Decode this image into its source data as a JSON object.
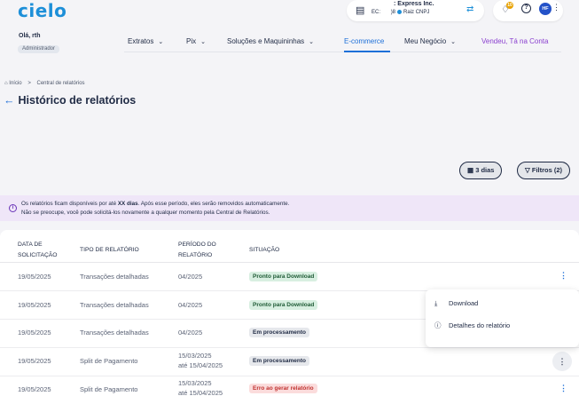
{
  "header": {
    "logo": "cielo",
    "company": {
      "name": ": Express Inc.",
      "cnpj_prefix": "EC: ",
      "cnpj_suffix": ")8",
      "root_label": "Raiz CNPJ"
    },
    "notification_count": "10",
    "help_symbol": "?",
    "avatar_initials": "HF",
    "user_greeting": "Olá,          rth",
    "role": "Administrador"
  },
  "nav": {
    "items": [
      {
        "label": "Extratos",
        "chevron": "⌄"
      },
      {
        "label": "Pix",
        "chevron": "⌄"
      },
      {
        "label": "Soluções e Maquininhas",
        "chevron": "⌄"
      },
      {
        "label": "E-commerce"
      },
      {
        "label": "Meu Negócio",
        "chevron": "⌄"
      },
      {
        "label": "Vendeu, Tá na Conta"
      }
    ]
  },
  "breadcrumb": {
    "home": "Início",
    "separator": ">",
    "current": "Central de relatórios"
  },
  "page_title": "Histórico de relatórios",
  "filters": {
    "period_label": "3 dias",
    "filters_label": "Filtros (2)"
  },
  "info_banner": {
    "line1_before": "Os relatórios ficam disponíveis por até ",
    "line1_bold": "XX dias",
    "line1_after": ". Após esse período, eles serão removidos automaticamente.",
    "line2": "Não se preocupe, você pode solicitá-los novamente a qualquer momento pela Central de Relatórios."
  },
  "table": {
    "headers": {
      "date_l1": "DATA DE",
      "date_l2": "SOLICITAÇÃO",
      "type": "TIPO DE RELATÓRIO",
      "period_l1": "PERÍODO DO",
      "period_l2": "RELATÓRIO",
      "status": "SITUAÇÃO"
    },
    "rows": [
      {
        "date": "19/05/2025",
        "type": "Transações detalhadas",
        "period": "04/2025",
        "status": "Pronto para Download"
      },
      {
        "date": "19/05/2025",
        "type": "Transações detalhadas",
        "period": "04/2025",
        "status": "Pronto para Download"
      },
      {
        "date": "19/05/2025",
        "type": "Transações detalhadas",
        "period": "04/2025",
        "status": "Em processamento"
      },
      {
        "date": "19/05/2025",
        "type": "Split de Pagamento",
        "period_l1": "15/03/2025",
        "period_l2": "até 15/04/2025",
        "status": "Em processamento"
      },
      {
        "date": "19/05/2025",
        "type": "Split de Pagamento",
        "period_l1": "15/03/2025",
        "period_l2": "até 15/04/2025",
        "status": "Erro ao gerar relatório"
      }
    ],
    "kebab_symbol": "⋮"
  },
  "row_menu": {
    "download": "Download",
    "details": "Detalhes do relatório"
  },
  "colors": {
    "primary": "#1d6fd8",
    "brand": "#1d8fd8",
    "banner_bg": "#efe6f8",
    "success_bg": "#d8efe1",
    "error_text": "#c0312f"
  }
}
